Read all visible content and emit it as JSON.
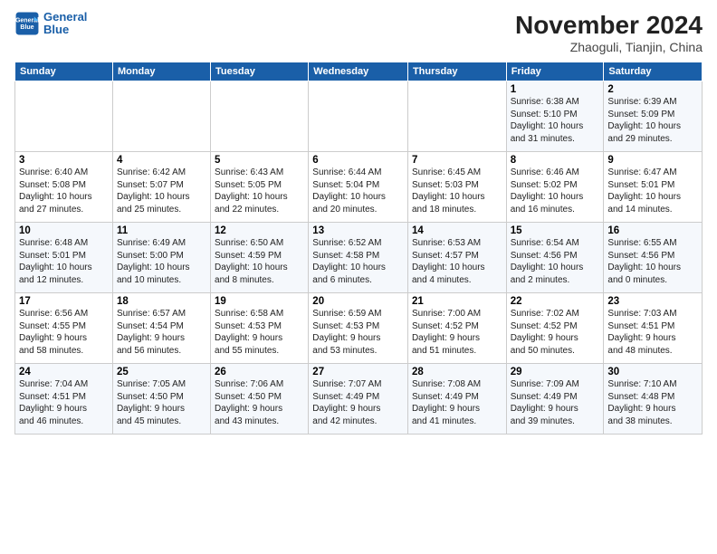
{
  "header": {
    "logo_line1": "General",
    "logo_line2": "Blue",
    "month_title": "November 2024",
    "location": "Zhaoguli, Tianjin, China"
  },
  "weekdays": [
    "Sunday",
    "Monday",
    "Tuesday",
    "Wednesday",
    "Thursday",
    "Friday",
    "Saturday"
  ],
  "weeks": [
    [
      {
        "day": "",
        "info": ""
      },
      {
        "day": "",
        "info": ""
      },
      {
        "day": "",
        "info": ""
      },
      {
        "day": "",
        "info": ""
      },
      {
        "day": "",
        "info": ""
      },
      {
        "day": "1",
        "info": "Sunrise: 6:38 AM\nSunset: 5:10 PM\nDaylight: 10 hours\nand 31 minutes."
      },
      {
        "day": "2",
        "info": "Sunrise: 6:39 AM\nSunset: 5:09 PM\nDaylight: 10 hours\nand 29 minutes."
      }
    ],
    [
      {
        "day": "3",
        "info": "Sunrise: 6:40 AM\nSunset: 5:08 PM\nDaylight: 10 hours\nand 27 minutes."
      },
      {
        "day": "4",
        "info": "Sunrise: 6:42 AM\nSunset: 5:07 PM\nDaylight: 10 hours\nand 25 minutes."
      },
      {
        "day": "5",
        "info": "Sunrise: 6:43 AM\nSunset: 5:05 PM\nDaylight: 10 hours\nand 22 minutes."
      },
      {
        "day": "6",
        "info": "Sunrise: 6:44 AM\nSunset: 5:04 PM\nDaylight: 10 hours\nand 20 minutes."
      },
      {
        "day": "7",
        "info": "Sunrise: 6:45 AM\nSunset: 5:03 PM\nDaylight: 10 hours\nand 18 minutes."
      },
      {
        "day": "8",
        "info": "Sunrise: 6:46 AM\nSunset: 5:02 PM\nDaylight: 10 hours\nand 16 minutes."
      },
      {
        "day": "9",
        "info": "Sunrise: 6:47 AM\nSunset: 5:01 PM\nDaylight: 10 hours\nand 14 minutes."
      }
    ],
    [
      {
        "day": "10",
        "info": "Sunrise: 6:48 AM\nSunset: 5:01 PM\nDaylight: 10 hours\nand 12 minutes."
      },
      {
        "day": "11",
        "info": "Sunrise: 6:49 AM\nSunset: 5:00 PM\nDaylight: 10 hours\nand 10 minutes."
      },
      {
        "day": "12",
        "info": "Sunrise: 6:50 AM\nSunset: 4:59 PM\nDaylight: 10 hours\nand 8 minutes."
      },
      {
        "day": "13",
        "info": "Sunrise: 6:52 AM\nSunset: 4:58 PM\nDaylight: 10 hours\nand 6 minutes."
      },
      {
        "day": "14",
        "info": "Sunrise: 6:53 AM\nSunset: 4:57 PM\nDaylight: 10 hours\nand 4 minutes."
      },
      {
        "day": "15",
        "info": "Sunrise: 6:54 AM\nSunset: 4:56 PM\nDaylight: 10 hours\nand 2 minutes."
      },
      {
        "day": "16",
        "info": "Sunrise: 6:55 AM\nSunset: 4:56 PM\nDaylight: 10 hours\nand 0 minutes."
      }
    ],
    [
      {
        "day": "17",
        "info": "Sunrise: 6:56 AM\nSunset: 4:55 PM\nDaylight: 9 hours\nand 58 minutes."
      },
      {
        "day": "18",
        "info": "Sunrise: 6:57 AM\nSunset: 4:54 PM\nDaylight: 9 hours\nand 56 minutes."
      },
      {
        "day": "19",
        "info": "Sunrise: 6:58 AM\nSunset: 4:53 PM\nDaylight: 9 hours\nand 55 minutes."
      },
      {
        "day": "20",
        "info": "Sunrise: 6:59 AM\nSunset: 4:53 PM\nDaylight: 9 hours\nand 53 minutes."
      },
      {
        "day": "21",
        "info": "Sunrise: 7:00 AM\nSunset: 4:52 PM\nDaylight: 9 hours\nand 51 minutes."
      },
      {
        "day": "22",
        "info": "Sunrise: 7:02 AM\nSunset: 4:52 PM\nDaylight: 9 hours\nand 50 minutes."
      },
      {
        "day": "23",
        "info": "Sunrise: 7:03 AM\nSunset: 4:51 PM\nDaylight: 9 hours\nand 48 minutes."
      }
    ],
    [
      {
        "day": "24",
        "info": "Sunrise: 7:04 AM\nSunset: 4:51 PM\nDaylight: 9 hours\nand 46 minutes."
      },
      {
        "day": "25",
        "info": "Sunrise: 7:05 AM\nSunset: 4:50 PM\nDaylight: 9 hours\nand 45 minutes."
      },
      {
        "day": "26",
        "info": "Sunrise: 7:06 AM\nSunset: 4:50 PM\nDaylight: 9 hours\nand 43 minutes."
      },
      {
        "day": "27",
        "info": "Sunrise: 7:07 AM\nSunset: 4:49 PM\nDaylight: 9 hours\nand 42 minutes."
      },
      {
        "day": "28",
        "info": "Sunrise: 7:08 AM\nSunset: 4:49 PM\nDaylight: 9 hours\nand 41 minutes."
      },
      {
        "day": "29",
        "info": "Sunrise: 7:09 AM\nSunset: 4:49 PM\nDaylight: 9 hours\nand 39 minutes."
      },
      {
        "day": "30",
        "info": "Sunrise: 7:10 AM\nSunset: 4:48 PM\nDaylight: 9 hours\nand 38 minutes."
      }
    ]
  ]
}
